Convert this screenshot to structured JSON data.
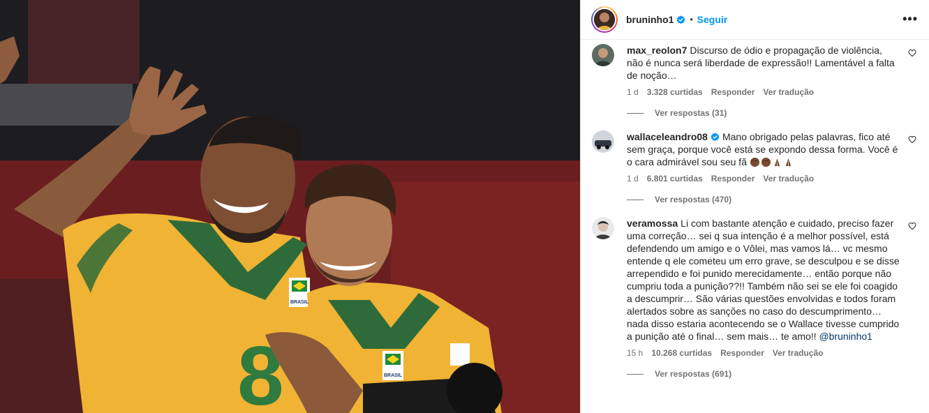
{
  "post": {
    "author": "bruninho1",
    "follow_label": "Seguir",
    "separator": "•",
    "more_label": "•••",
    "icons": {
      "verified": "verified-badge-icon",
      "more": "more-options-icon",
      "like": "heart-icon"
    },
    "photo": {
      "jersey_labels": [
        "BRASIL",
        "BRASIL"
      ],
      "jersey_number": "8"
    }
  },
  "comments": [
    {
      "user": "max_reolon7",
      "verified": false,
      "text": "Discurso de ódio e propagação de violência, não é nunca será liberdade de expressão!! Lamentável a falta de noção…",
      "time": "1 d",
      "likes": "3.328 curtidas",
      "reply_label": "Responder",
      "translate_label": "Ver tradução",
      "view_replies": "Ver respostas (31)"
    },
    {
      "user": "wallaceleandro08",
      "verified": true,
      "text": "Mano obrigado pelas palavras, fico até sem graça, porque você está se expondo dessa forma. Você é o cara admirável sou seu fã ",
      "time": "1 d",
      "likes": "6.801 curtidas",
      "reply_label": "Responder",
      "translate_label": "Ver tradução",
      "view_replies": "Ver respostas (470)"
    },
    {
      "user": "veramossa",
      "verified": false,
      "text": "Li com bastante atenção e cuidado, preciso fazer uma correção… sei q sua intenção é a melhor possível, está defendendo um amigo e o Vôlei, mas vamos lá… vc mesmo entende q ele cometeu um erro grave, se desculpou e se disse arrependido e foi punido merecidamente… então porque não cumpriu toda a punição??!! Também não sei se ele foi coagido a descumprir… São várias questões envolvidas e todos foram alertados sobre as sanções no caso do descumprimento… nada disso estaria acontecendo se o Wallace tivesse cumprido a punição até o final… sem mais… te amo!! ",
      "mention": "@bruninho1",
      "time": "15 h",
      "likes": "10.268 curtidas",
      "reply_label": "Responder",
      "translate_label": "Ver tradução",
      "view_replies": "Ver respostas (691)"
    }
  ],
  "colors": {
    "accent": "#0095f6",
    "mention": "#00376b",
    "muted": "#737373",
    "jersey_yellow": "#f2b632",
    "jersey_green": "#2f6b3a"
  }
}
